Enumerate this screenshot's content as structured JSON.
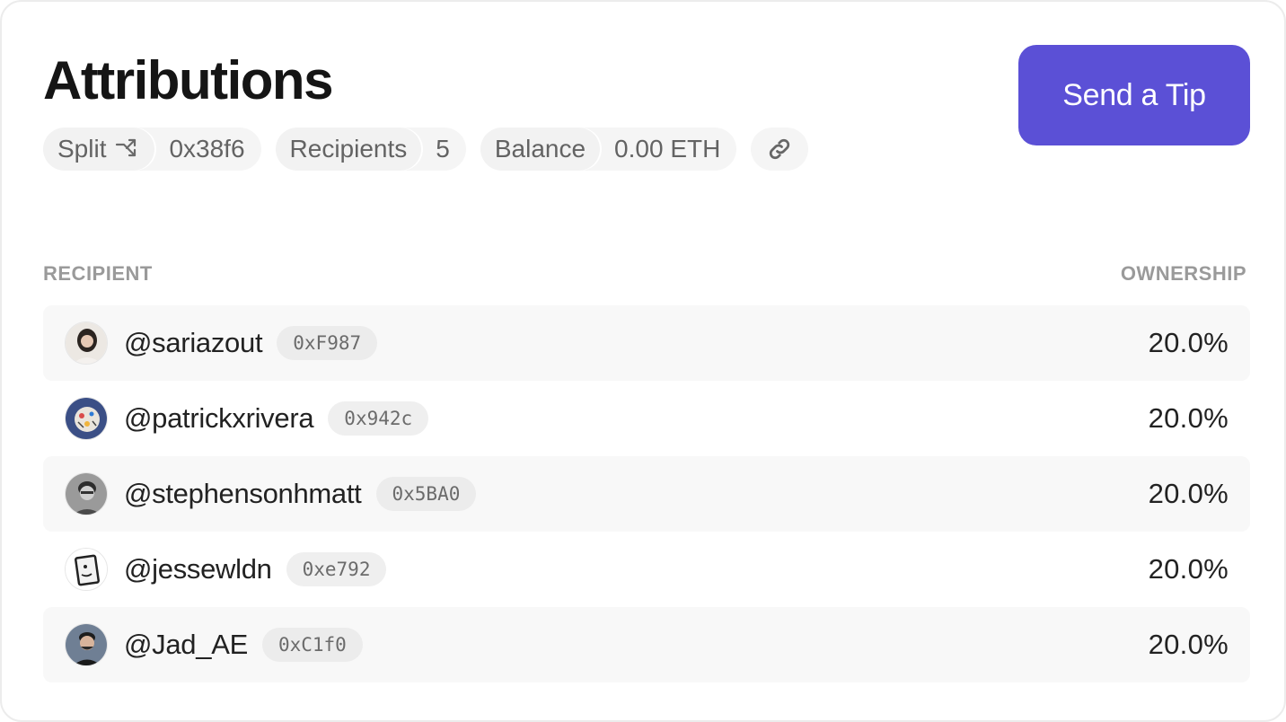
{
  "header": {
    "title": "Attributions",
    "tip_button": "Send a Tip"
  },
  "meta": {
    "split_label": "Split",
    "split_icon": "split-arrows-icon",
    "split_value": "0x38f6",
    "recipients_label": "Recipients",
    "recipients_value": "5",
    "balance_label": "Balance",
    "balance_value": "0.00 ETH",
    "link_icon": "link-icon"
  },
  "table": {
    "col_recipient": "RECIPIENT",
    "col_ownership": "OWNERSHIP",
    "rows": [
      {
        "handle": "@sariazout",
        "address": "0xF987",
        "ownership": "20.0%"
      },
      {
        "handle": "@patrickxrivera",
        "address": "0x942c",
        "ownership": "20.0%"
      },
      {
        "handle": "@stephensonhmatt",
        "address": "0x5BA0",
        "ownership": "20.0%"
      },
      {
        "handle": "@jessewldn",
        "address": "0xe792",
        "ownership": "20.0%"
      },
      {
        "handle": "@Jad_AE",
        "address": "0xC1f0",
        "ownership": "20.0%"
      }
    ]
  },
  "colors": {
    "accent": "#5b50d6",
    "row_shade": "#f8f8f8",
    "muted_text": "#9a9a9a"
  }
}
